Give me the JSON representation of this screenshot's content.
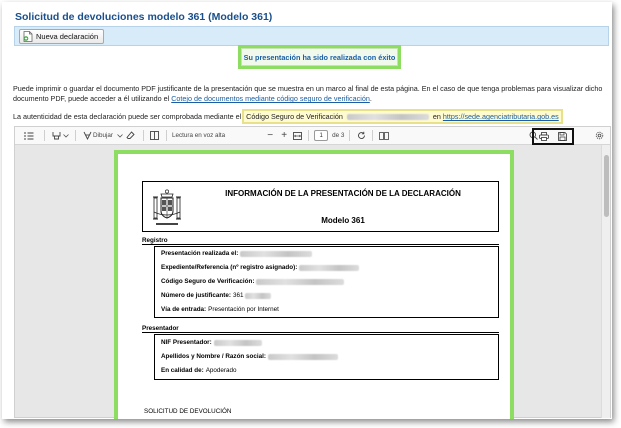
{
  "header": {
    "title": "Solicitud de devoluciones modelo 361 (Modelo 361)"
  },
  "toolbar": {
    "new_button_label": "Nueva declaración"
  },
  "status": {
    "success_message": "Su presentación ha sido realizada con éxito"
  },
  "info": {
    "paragraph_text": "Puede imprimir o guardar el documento PDF justificante de la presentación que se muestra en un marco al final de esta página. En el caso de que tenga problemas para visualizar dicho documento PDF, puede acceder a él utilizando el ",
    "paragraph_link": "Cotejo de documentos mediante código seguro de verificación",
    "paragraph_end": ".",
    "auth_prefix": "La autenticidad de esta declaración puede ser comprobada mediante el",
    "auth_csv_label": "Código Seguro de Verificación",
    "auth_en": "en",
    "auth_url": "https://sede.agenciatributaria.gob.es"
  },
  "viewer": {
    "draw_label": "Dibujar",
    "read_aloud_label": "Lectura en voz alta",
    "current_page": "1",
    "page_of": "de 3",
    "icons": [
      "contents-icon",
      "highlight-icon",
      "draw-icon",
      "eraser-icon",
      "page-view-icon",
      "zoom-out-icon",
      "zoom-in-icon",
      "fit-width-icon",
      "rotate-icon",
      "two-page-icon",
      "search-icon",
      "print-icon",
      "save-icon",
      "settings-icon"
    ]
  },
  "document": {
    "title": "INFORMACIÓN DE LA PRESENTACIÓN DE LA DECLARACIÓN",
    "model": "Modelo 361",
    "registro_label": "Registro",
    "registro_fields": [
      {
        "label": "Presentación realizada el:",
        "value": ""
      },
      {
        "label": "Expediente/Referencia (nº registro asignado):",
        "value": ""
      },
      {
        "label": "Código Seguro de Verificación:",
        "value": ""
      },
      {
        "label": "Número de justificante:",
        "value": "361"
      },
      {
        "label": "Vía de entrada:",
        "value": "Presentación por Internet"
      }
    ],
    "presentador_label": "Presentador",
    "presentador_fields": [
      {
        "label": "NIF Presentador:",
        "value": ""
      },
      {
        "label": "Apellidos y Nombre / Razón social:",
        "value": ""
      },
      {
        "label": "En calidad de:",
        "value": "Apoderado"
      }
    ],
    "solicitud_text": "SOLICITUD DE DEVOLUCIÓN"
  },
  "colors": {
    "title_blue": "#1a4f8b",
    "link_blue": "#1a5fa6",
    "highlight_green": "#8cdd62",
    "actionbar_blue": "#d8ebf9"
  }
}
